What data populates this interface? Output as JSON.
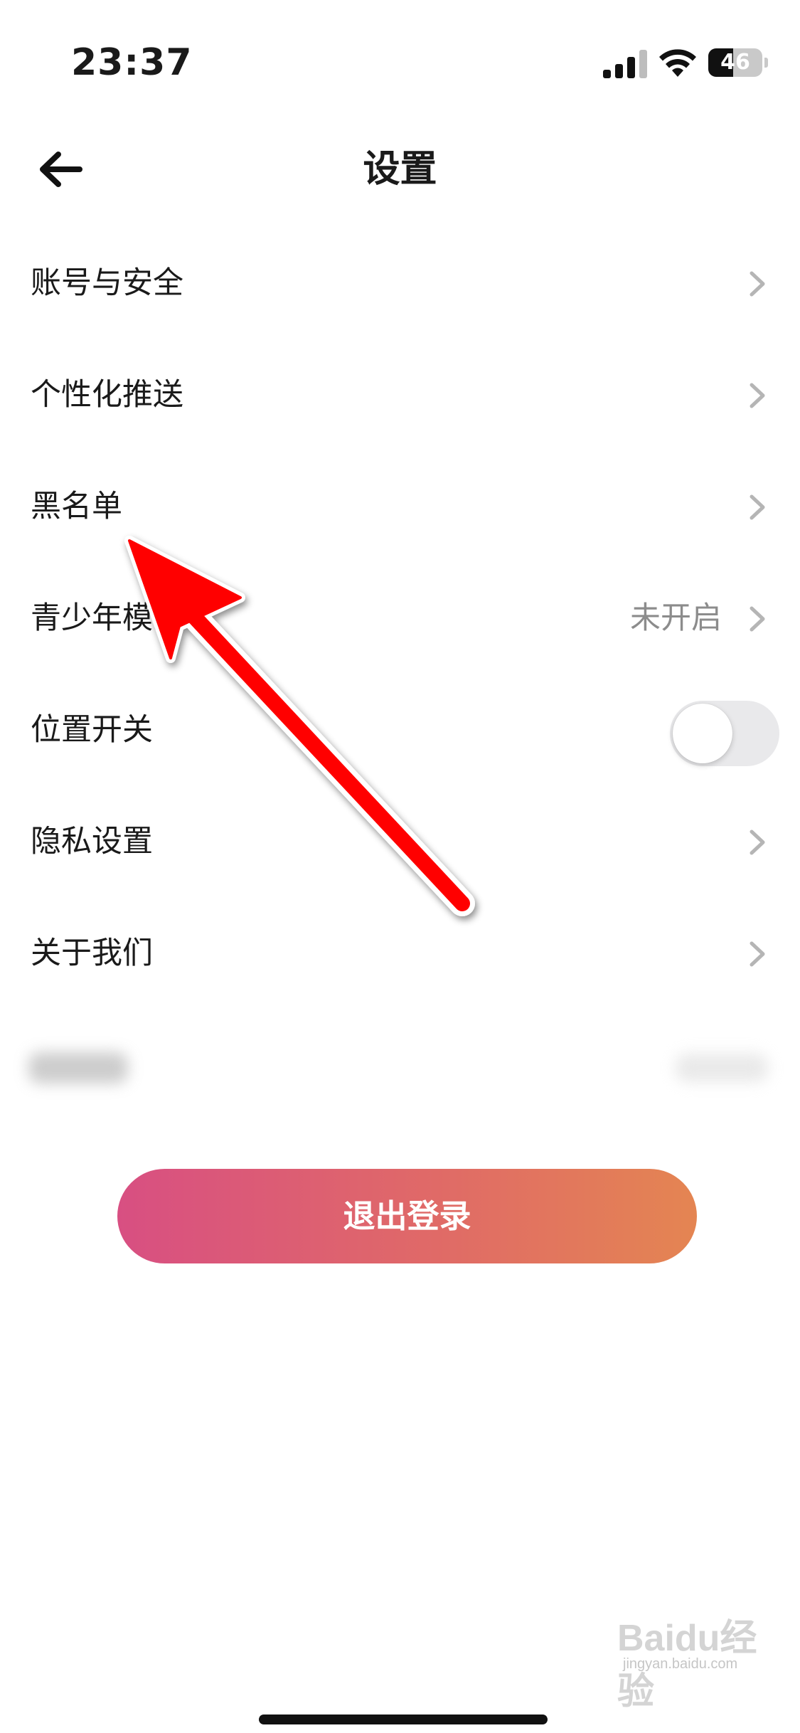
{
  "status_bar": {
    "time": "23:37",
    "battery_level": "46",
    "battery_fraction": 0.46,
    "icons": [
      "cellular-signal-icon",
      "wifi-icon",
      "battery-icon"
    ]
  },
  "header": {
    "title": "设置",
    "back_icon": "back-arrow-icon"
  },
  "settings": {
    "items": [
      {
        "label": "账号与安全",
        "control": "chevron"
      },
      {
        "label": "个性化推送",
        "control": "chevron"
      },
      {
        "label": "黑名单",
        "control": "chevron"
      },
      {
        "label": "青少年模式",
        "value": "未开启",
        "control": "chevron"
      },
      {
        "label": "位置开关",
        "control": "toggle",
        "toggle_on": false
      },
      {
        "label": "隐私设置",
        "control": "chevron"
      },
      {
        "label": "关于我们",
        "control": "chevron"
      }
    ]
  },
  "logout": {
    "label": "退出登录",
    "gradient_start": "#d84f82",
    "gradient_end": "#e48552"
  },
  "annotation": {
    "color": "#ff0000",
    "points_to": "黑名单"
  },
  "watermark": {
    "text": "Baidu经验",
    "subtext": "jingyan.baidu.com"
  }
}
